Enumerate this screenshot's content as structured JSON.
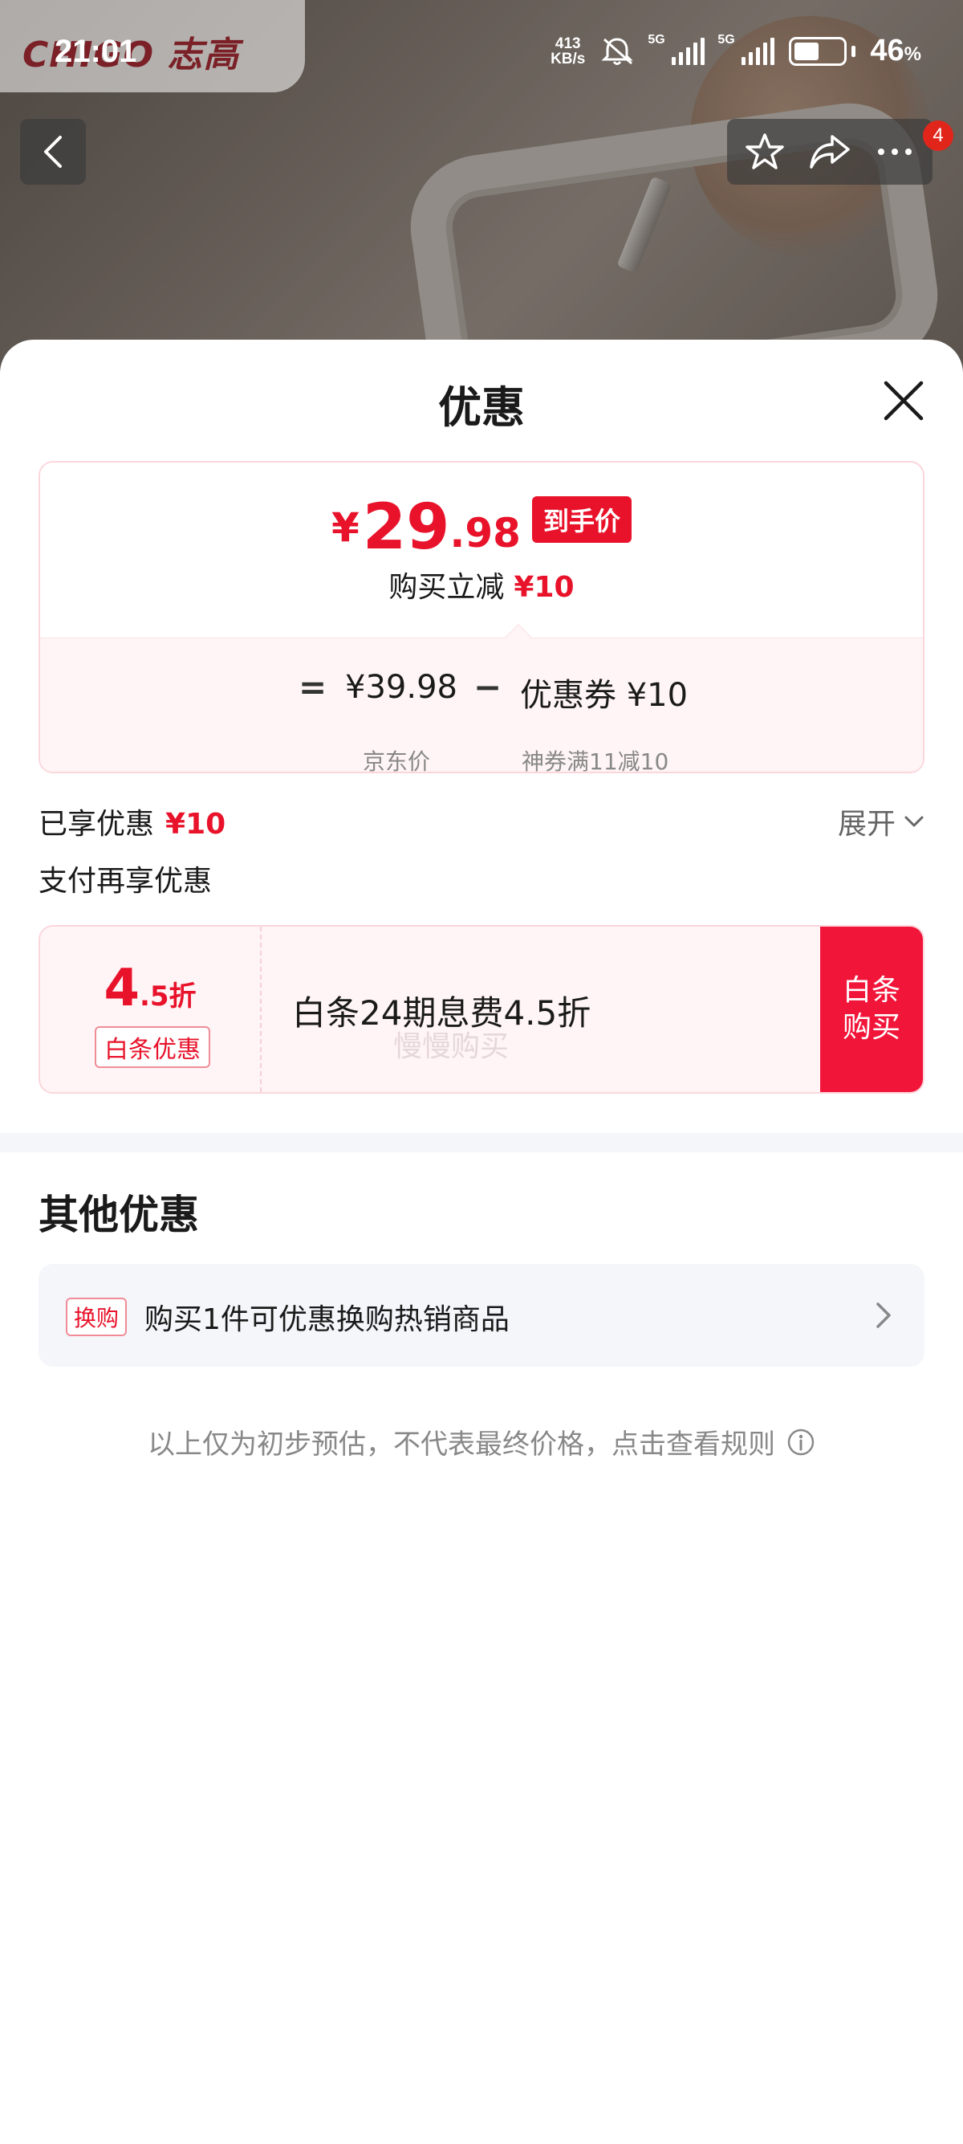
{
  "status_bar": {
    "time": "21:01",
    "net_speed_value": "413",
    "net_speed_unit": "KB/s",
    "signal1_label": "5G",
    "signal2_label": "5G",
    "battery_percent": "46",
    "battery_unit": "%"
  },
  "brand": {
    "logo_text": "CHIGO 志高"
  },
  "top_actions": {
    "badge_count": "4"
  },
  "sheet": {
    "title": "优惠",
    "price": {
      "currency": "¥",
      "integer": "29",
      "decimal": ".98",
      "final_tag": "到手价",
      "instant_label": "购买立减",
      "instant_value": "¥10"
    },
    "formula": {
      "equals": "=",
      "jd_price": "¥39.98",
      "jd_price_label": "京东价",
      "minus": "−",
      "coupon": "优惠券 ¥10",
      "coupon_label": "神券满11减10"
    },
    "enjoyed_label": "已享优惠",
    "enjoyed_value": "¥10",
    "expand_label": "展开",
    "pay_more_label": "支付再享优惠",
    "baitiao": {
      "discount_big": "4",
      "discount_small": ".5折",
      "tag": "白条优惠",
      "description": "白条24期息费4.5折",
      "watermark": "慢慢购买",
      "button": "白条购买"
    },
    "other_title": "其他优惠",
    "exchange": {
      "tag": "换购",
      "text": "购买1件可优惠换购热销商品"
    },
    "disclaimer": "以上仅为初步预估，不代表最终价格，点击查看规则"
  }
}
